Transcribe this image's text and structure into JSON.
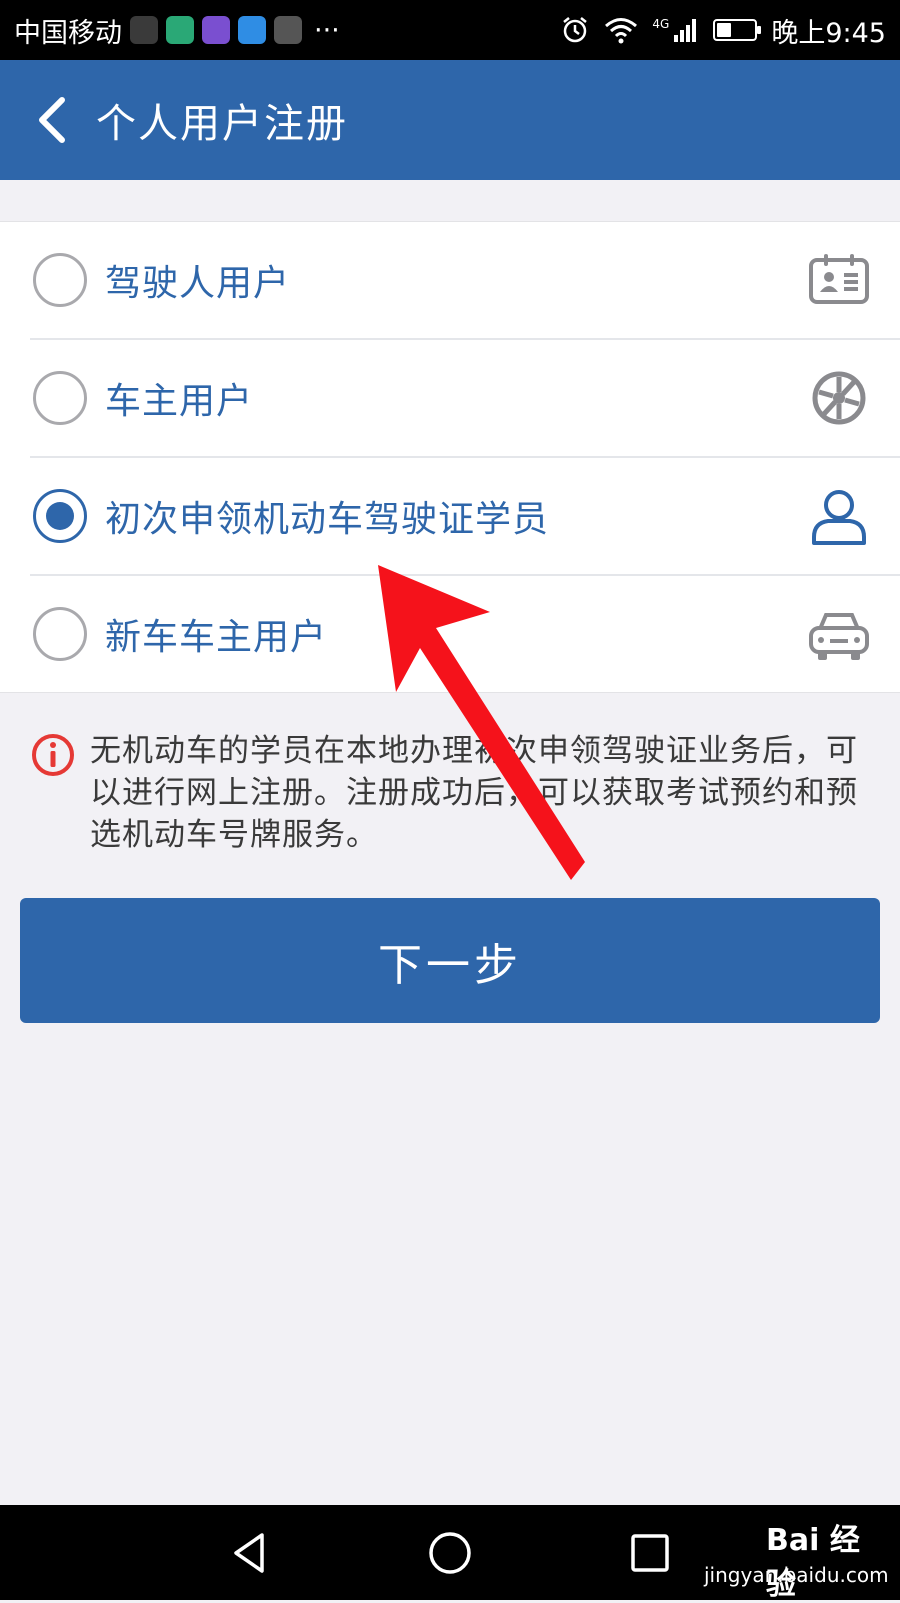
{
  "status_bar": {
    "carrier": "中国移动",
    "more": "···",
    "network": "4G",
    "time": "晚上9:45",
    "battery_level": 0.4,
    "app_icon_colors": [
      "#3a3a3a",
      "#2aa876",
      "#7a4fd0",
      "#2f8de4",
      "#555555"
    ]
  },
  "header": {
    "title": "个人用户注册",
    "back_icon": "chevron-left-icon",
    "background": "#2e66aa"
  },
  "options": [
    {
      "label": "驾驶人用户",
      "icon": "id-card-icon",
      "selected": false
    },
    {
      "label": "车主用户",
      "icon": "wheel-icon",
      "selected": false
    },
    {
      "label": "初次申领机动车驾驶证学员",
      "icon": "person-icon",
      "selected": true
    },
    {
      "label": "新车车主用户",
      "icon": "car-icon",
      "selected": false
    }
  ],
  "notice": {
    "icon": "info-icon",
    "text": "无机动车的学员在本地办理初次申领驾驶证业务后，可以进行网上注册。注册成功后，可以获取考试预约和预选机动车号牌服务。"
  },
  "next_button": {
    "label": "下一步"
  },
  "nav_bar": {
    "back": "back-icon",
    "home": "home-icon",
    "recents": "recents-icon"
  },
  "watermark": {
    "brand": "Bai 经验",
    "url": "jingyan.baidu.com"
  },
  "colors": {
    "accent": "#2e66aa",
    "annotation_arrow": "#f5121b",
    "notice_icon": "#e53935"
  }
}
